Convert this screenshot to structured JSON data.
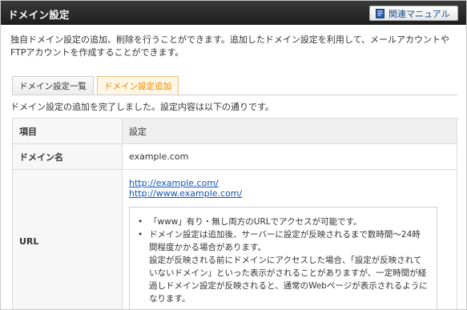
{
  "header": {
    "title": "ドメイン設定",
    "manual_button": "関連マニュアル"
  },
  "description": "独自ドメイン設定の追加、削除を行うことができます。追加したドメイン設定を利用して、メールアカウントやFTPアカウントを作成することができます。",
  "tabs": [
    {
      "label": "ドメイン設定一覧",
      "active": false
    },
    {
      "label": "ドメイン設定追加",
      "active": true
    }
  ],
  "notice": "ドメイン設定の追加を完了しました。設定内容は以下の通りです。",
  "table": {
    "headers": [
      "項目",
      "設定"
    ],
    "domain_label": "ドメイン名",
    "domain_value": "example.com",
    "url_label": "URL",
    "links": [
      "http://example.com/",
      "http://www.example.com/"
    ],
    "notes": {
      "bullet1": "「www」有り・無し両方のURLでアクセスが可能です。",
      "bullet2": "ドメイン設定は追加後、サーバーに設定が反映されるまで数時間～24時間程度かかる場合があります。",
      "continuation": "設定が反映される前にドメインにアクセスした場合、「設定が反映されていないドメイン」といった表示がされることがありますが、一定時間が経過しドメイン設定が反映されると、通常のWebページが表示されるようになります。"
    }
  },
  "colors": {
    "titlebar": "#2a2a2a",
    "active_tab": "#e98a00",
    "link": "#1155bb"
  }
}
